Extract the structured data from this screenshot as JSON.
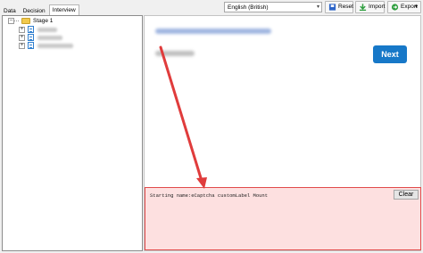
{
  "tabs": [
    {
      "label": "Data"
    },
    {
      "label": "Decision"
    },
    {
      "label": "Interview"
    }
  ],
  "toolbar": {
    "language": "English (British)",
    "reset_label": "Reset",
    "import_label": "Import",
    "export_label": "Export"
  },
  "tree": {
    "root_label": "Stage 1"
  },
  "interview": {
    "next_label": "Next"
  },
  "log": {
    "text": "Starting name:eCaptcha customLabel Mount",
    "clear_label": "Clear"
  },
  "colors": {
    "next_bg": "#1778c8",
    "log_bg": "#fde0e0",
    "log_border": "#e14a4a",
    "arrow": "#e03c3c"
  },
  "icons": [
    "reset-icon",
    "import-icon",
    "export-icon",
    "folder-icon",
    "document-icon",
    "dropdown-arrow-icon",
    "cursor-icon"
  ]
}
